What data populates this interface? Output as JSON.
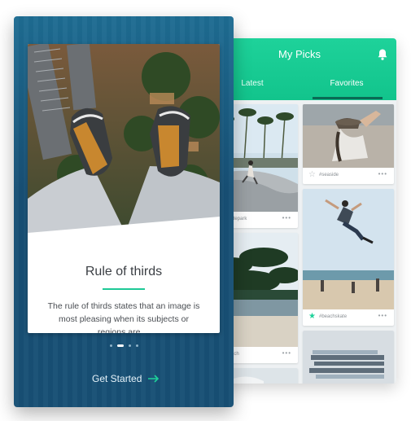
{
  "colors": {
    "accent": "#1ed29a",
    "onboard_bg": "#174f74"
  },
  "picks": {
    "title": "My Picks",
    "tabs": [
      {
        "label": "Latest"
      },
      {
        "label": "Favorites"
      }
    ],
    "cards": [
      {
        "caption": "#seaside",
        "favorited": false
      },
      {
        "caption": "#beachskate",
        "favorited": true
      },
      {
        "caption": "#skatepark",
        "favorited": false
      },
      {
        "caption": "#beach",
        "favorited": false
      }
    ],
    "more_glyph": "•••"
  },
  "onboarding": {
    "card_title": "Rule of thirds",
    "card_body": "The rule of thirds states that an image is\nmost pleasing when its subjects or\nregions are ...",
    "pager": {
      "count": 4,
      "active_index": 1
    },
    "cta_label": "Get Started",
    "cta_arrow": "→"
  }
}
